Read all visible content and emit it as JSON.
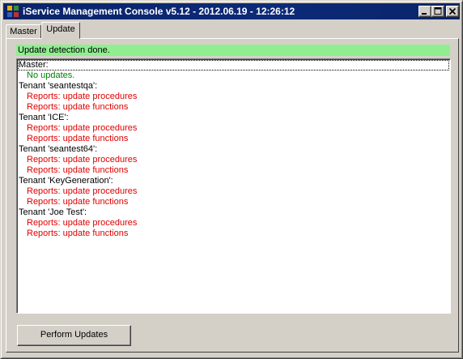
{
  "window": {
    "title": "iService Management Console v5.12 - 2012.06.19 - 12:26:12"
  },
  "tabs": [
    {
      "label": "Master",
      "selected": false
    },
    {
      "label": "Update",
      "selected": true
    }
  ],
  "update_tab": {
    "status_message": "Update detection done.",
    "status_color": "#90ee90",
    "log": [
      {
        "text": "Master:",
        "kind": "header"
      },
      {
        "text": "No updates.",
        "kind": "ok"
      },
      {
        "text": "Tenant 'seantestqa':",
        "kind": "header"
      },
      {
        "text": "Reports: update procedures",
        "kind": "err"
      },
      {
        "text": "Reports: update functions",
        "kind": "err"
      },
      {
        "text": "Tenant 'ICE':",
        "kind": "header"
      },
      {
        "text": "Reports: update procedures",
        "kind": "err"
      },
      {
        "text": "Reports: update functions",
        "kind": "err"
      },
      {
        "text": "Tenant 'seantest64':",
        "kind": "header"
      },
      {
        "text": "Reports: update procedures",
        "kind": "err"
      },
      {
        "text": "Reports: update functions",
        "kind": "err"
      },
      {
        "text": "Tenant 'KeyGeneration':",
        "kind": "header"
      },
      {
        "text": "Reports: update procedures",
        "kind": "err"
      },
      {
        "text": "Reports: update functions",
        "kind": "err"
      },
      {
        "text": "Tenant 'Joe Test':",
        "kind": "header"
      },
      {
        "text": "Reports: update procedures",
        "kind": "err"
      },
      {
        "text": "Reports: update functions",
        "kind": "err"
      }
    ],
    "perform_button_label": "Perform Updates"
  },
  "colors": {
    "ok_text": "#008000",
    "error_text": "#e00000",
    "titlebar": "#0a246a"
  }
}
